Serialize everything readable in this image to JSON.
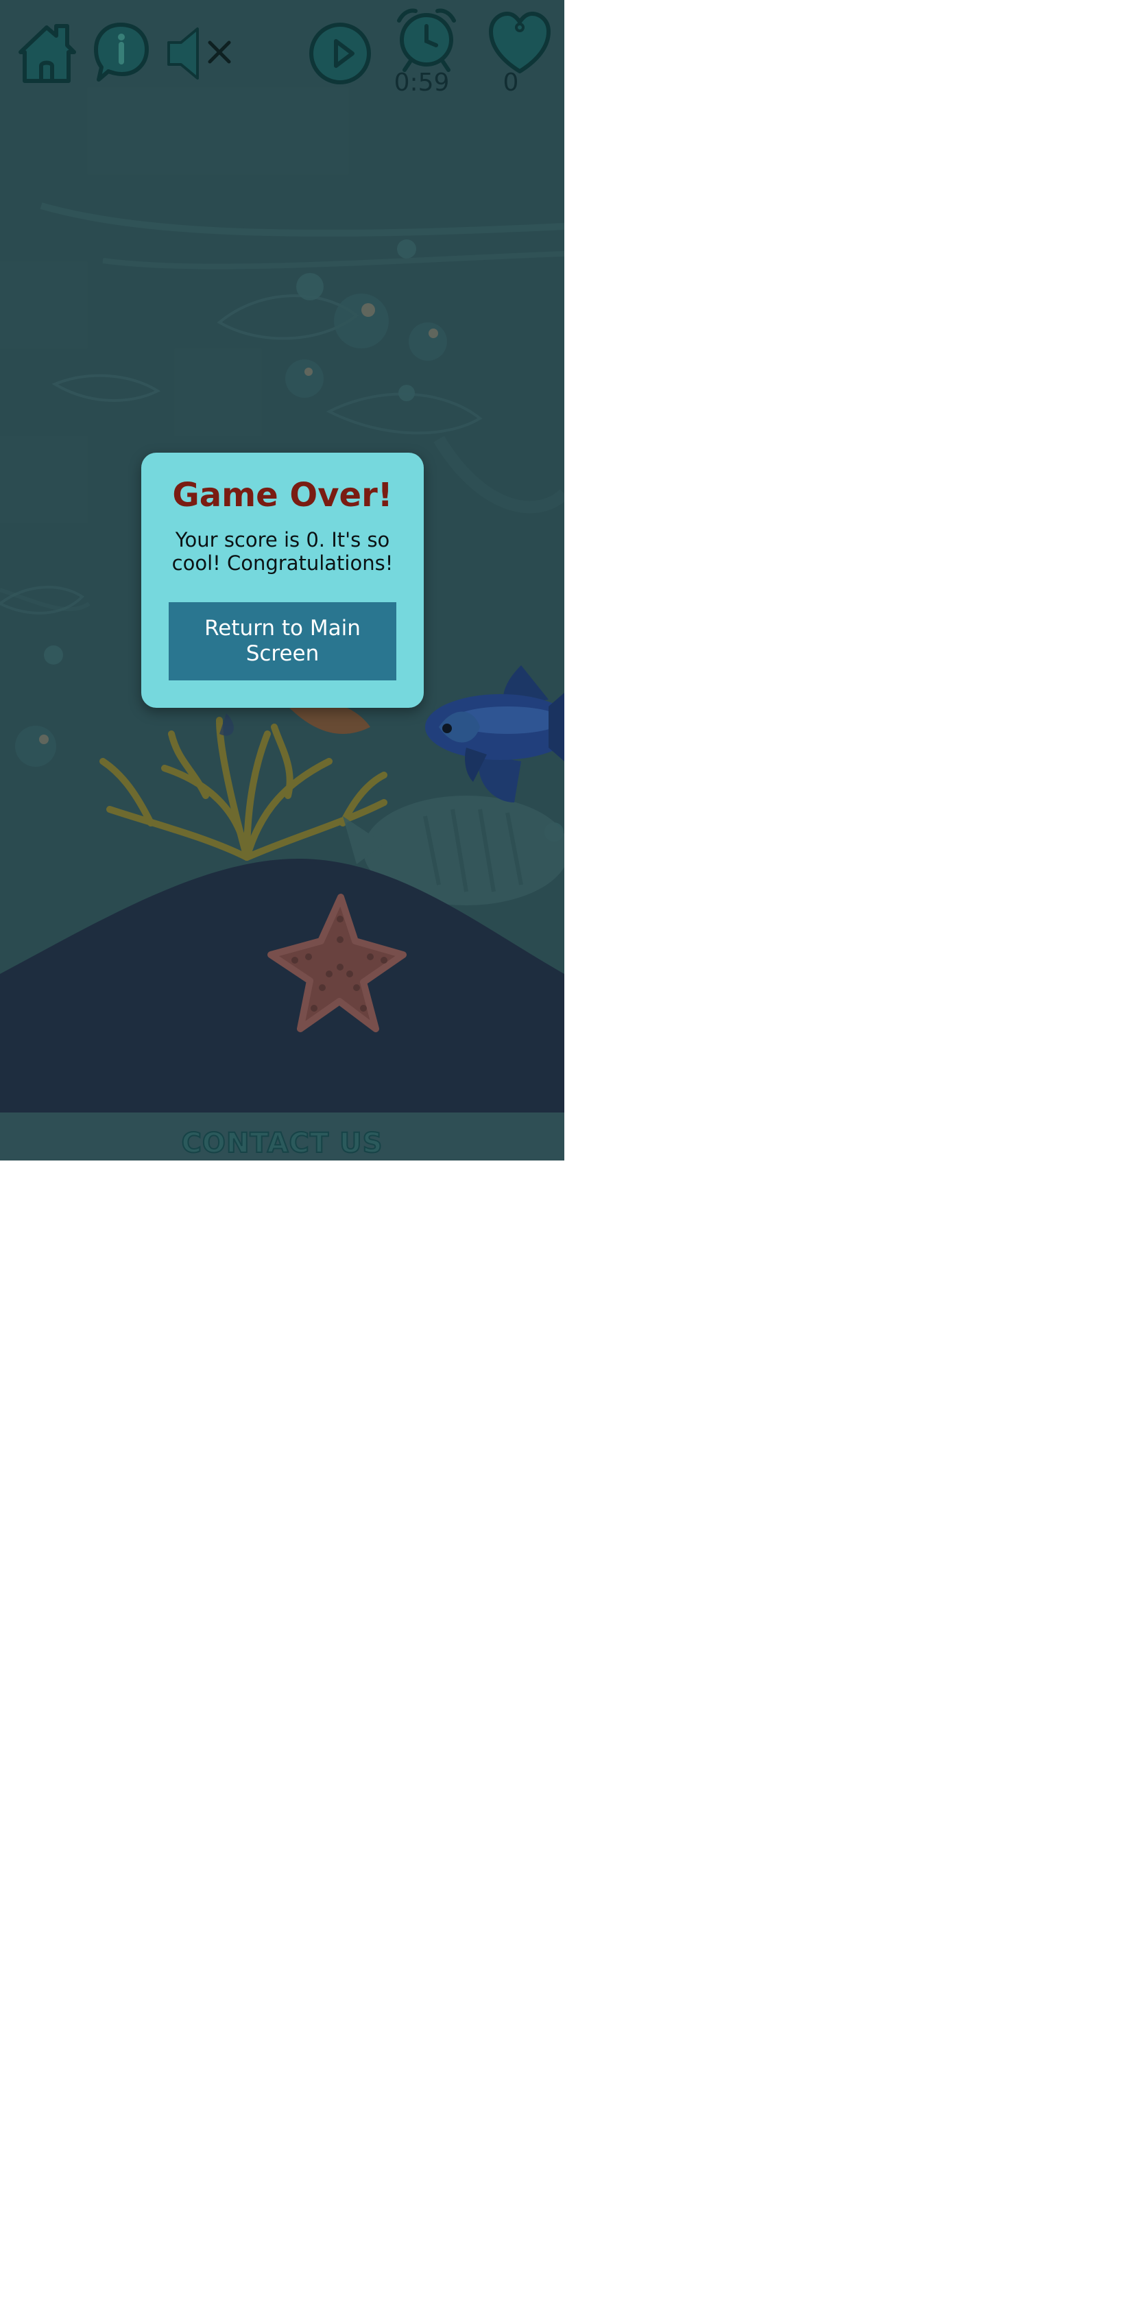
{
  "toolbar": {
    "home_icon": "home-icon",
    "info_icon": "info-icon",
    "sound_icon": "sound-muted-icon",
    "play_icon": "play-icon",
    "timer_icon": "alarm-clock-icon",
    "score_icon": "heart-icon",
    "timer": "0:59",
    "score": "0"
  },
  "modal": {
    "title": "Game Over!",
    "message": "Your score is 0. It's so cool! Congratulations!",
    "button_label": "Return to Main Screen"
  },
  "footer": {
    "contact_label": "CONTACT US"
  },
  "colors": {
    "background": "#2f4f55",
    "modal": "#76d8dd",
    "title": "#7a1c12",
    "button": "#2a7690",
    "seabed": "#1f2a40",
    "starfish": "#7a4440"
  }
}
